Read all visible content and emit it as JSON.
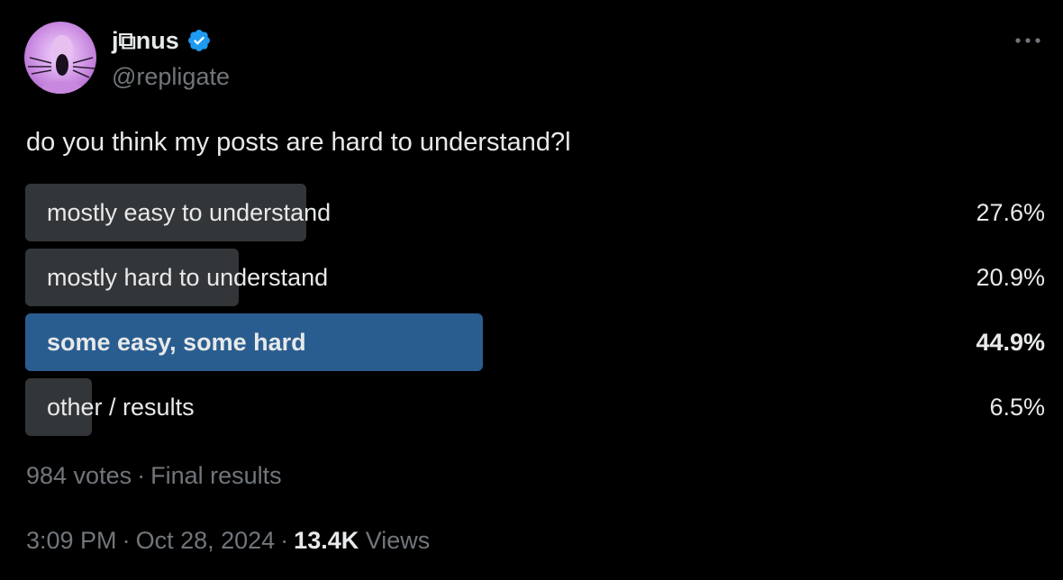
{
  "author": {
    "display_name": "j⧉nus",
    "handle": "@repligate",
    "verified": true,
    "verified_color": "#1d9bf0"
  },
  "more_icon": "more-horizontal-icon",
  "tweet": {
    "text": "do you think my posts are hard to understand?l"
  },
  "poll": {
    "options": [
      {
        "label": "mostly easy to understand",
        "percent_text": "27.6%",
        "percent": 27.6,
        "winner": false
      },
      {
        "label": "mostly hard to understand",
        "percent_text": "20.9%",
        "percent": 20.9,
        "winner": false
      },
      {
        "label": "some easy, some hard",
        "percent_text": "44.9%",
        "percent": 44.9,
        "winner": true
      },
      {
        "label": "other / results",
        "percent_text": "6.5%",
        "percent": 6.5,
        "winner": false
      }
    ],
    "votes": "984 votes",
    "status": "Final results",
    "bar_color": "#333639",
    "winner_color": "#2a5d8f"
  },
  "meta": {
    "time": "3:09 PM",
    "date": "Oct 28, 2024",
    "views_count": "13.4K",
    "views_label": "Views"
  }
}
